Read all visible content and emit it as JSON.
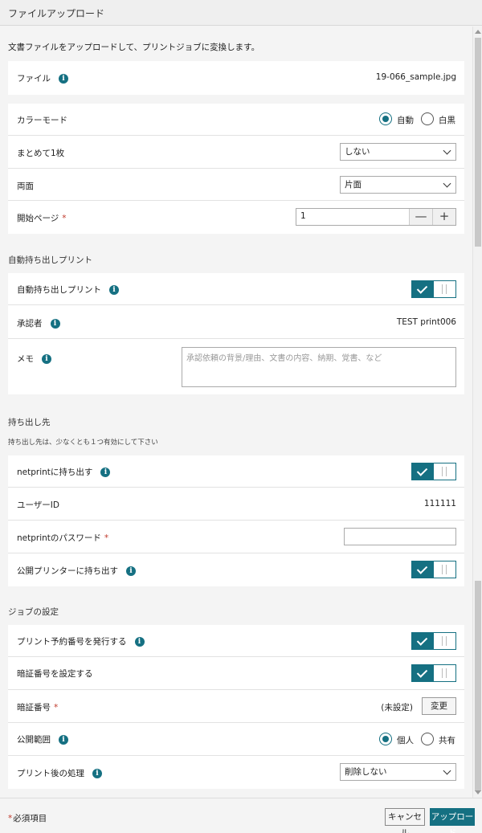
{
  "window": {
    "title": "ファイルアップロード"
  },
  "intro": "文書ファイルをアップロードして、プリントジョブに変換します。",
  "file": {
    "label": "ファイル",
    "value": "19-066_sample.jpg"
  },
  "print_settings": {
    "color_mode": {
      "label": "カラーモード",
      "options": [
        "自動",
        "白黒"
      ],
      "selected": "自動"
    },
    "nup": {
      "label": "まとめて1枚",
      "value": "しない"
    },
    "duplex": {
      "label": "両面",
      "value": "片面"
    },
    "start_page": {
      "label": "開始ページ",
      "value": "1",
      "minus": "—",
      "plus": "+"
    }
  },
  "auto_takeout": {
    "section_title": "自動持ち出しプリント",
    "toggle_label": "自動持ち出しプリント",
    "toggle_on": true,
    "approver_label": "承認者",
    "approver_value": "TEST print006",
    "memo_label": "メモ",
    "memo_placeholder": "承認依頼の背景/理由、文書の内容、納期、覚書、など"
  },
  "destination": {
    "section_title": "持ち出し先",
    "note": "持ち出し先は、少なくとも１つ有効にして下さい",
    "netprint_label": "netprintに持ち出す",
    "netprint_on": true,
    "user_id_label": "ユーザーID",
    "user_id_value": "111111",
    "password_label": "netprintのパスワード",
    "public_printer_label": "公開プリンターに持ち出す",
    "public_printer_on": true
  },
  "job_settings": {
    "section_title": "ジョブの設定",
    "reservation_label": "プリント予約番号を発行する",
    "reservation_on": true,
    "pin_set_label": "暗証番号を設定する",
    "pin_set_on": true,
    "pin_label": "暗証番号",
    "pin_value": "(未設定)",
    "pin_change": "変更",
    "scope_label": "公開範囲",
    "scope_options": [
      "個人",
      "共有"
    ],
    "scope_selected": "個人",
    "after_label": "プリント後の処理",
    "after_value": "削除しない"
  },
  "footer": {
    "required_mark": "*",
    "required_note": "必須項目",
    "cancel_label": "キャンセル",
    "upload_label": "アップロード"
  },
  "colors": {
    "accent": "#157082",
    "required": "#c0392b"
  }
}
